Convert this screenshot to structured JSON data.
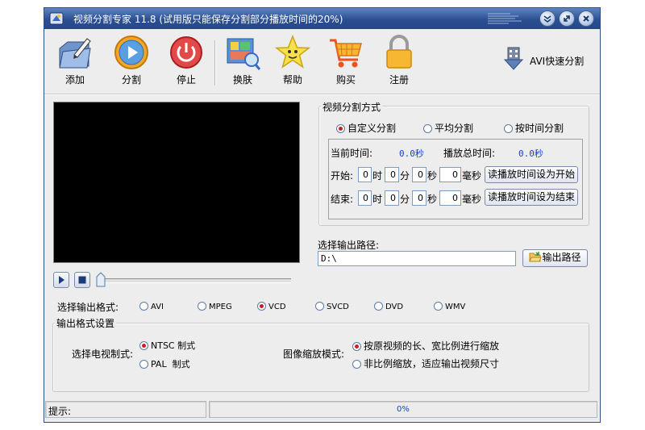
{
  "window": {
    "title": "视频分割专家 11.8 (试用版只能保存分割部分播放时间的20%)",
    "controls": [
      "minimize-icon",
      "restore-icon",
      "close-icon"
    ]
  },
  "toolbar": {
    "add": "添加",
    "split": "分割",
    "stop": "停止",
    "skin": "换肤",
    "help": "帮助",
    "buy": "购买",
    "register": "注册",
    "avi_quick": "AVI快速分割"
  },
  "split_mode": {
    "title": "视频分割方式",
    "options": [
      "自定义分割",
      "平均分割",
      "按时间分割"
    ],
    "selected": "自定义分割",
    "current_time_label": "当前时间:",
    "current_time_value": "0.0秒",
    "total_time_label": "播放总时间:",
    "total_time_value": "0.0秒",
    "start_label": "开始:",
    "end_label": "结束:",
    "unit_hour": "时",
    "unit_min": "分",
    "unit_sec": "秒",
    "unit_ms": "毫秒",
    "start": {
      "h": "0",
      "m": "0",
      "s": "0",
      "ms": "0"
    },
    "end": {
      "h": "0",
      "m": "0",
      "s": "0",
      "ms": "0"
    },
    "set_start_button": "读播放时间设为开始",
    "set_end_button": "读播放时间设为结束"
  },
  "output_path": {
    "label": "选择输出路径:",
    "value": "D:\\",
    "button": "输出路径"
  },
  "output_format": {
    "label": "选择输出格式:",
    "options": [
      "AVI",
      "MPEG",
      "VCD",
      "SVCD",
      "DVD",
      "WMV"
    ],
    "selected": "VCD"
  },
  "format_settings": {
    "title": "输出格式设置",
    "tv_label": "选择电视制式:",
    "tv_options": [
      "NTSC 制式",
      "PAL  制式"
    ],
    "tv_selected": "NTSC 制式",
    "scale_label": "图像缩放模式:",
    "scale_options": [
      "按原视频的长、宽比例进行缩放",
      "非比例缩放，适应输出视频尺寸"
    ],
    "scale_selected": "按原视频的长、宽比例进行缩放"
  },
  "status": {
    "hint_label": "提示:",
    "progress_text": "0%",
    "progress": 0
  },
  "colors": {
    "title_bar": "#2c4f92",
    "value_text": "#1a40c8",
    "radio_selected": "#c82020"
  }
}
